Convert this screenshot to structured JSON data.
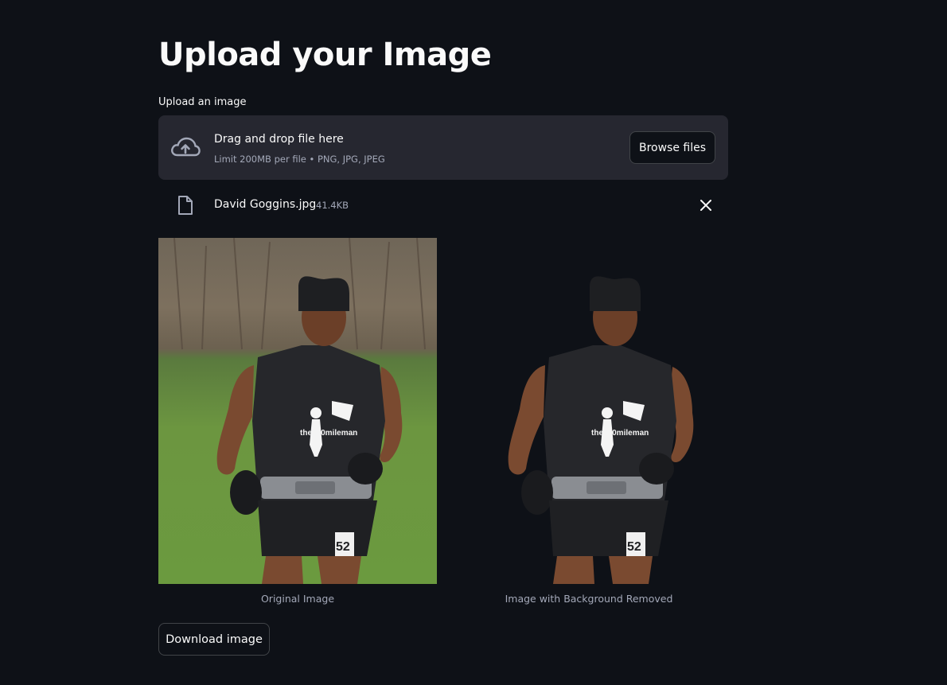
{
  "page": {
    "title": "Upload your Image",
    "upload_label": "Upload an image"
  },
  "uploader": {
    "drag_text": "Drag and drop file here",
    "limit_text": "Limit 200MB per file • PNG, JPG, JPEG",
    "browse_label": "Browse files",
    "icon": "cloud-upload-icon"
  },
  "uploaded_file": {
    "name": "David Goggins.jpg",
    "size": "41.4KB",
    "icon": "file-icon",
    "remove_icon": "close-icon"
  },
  "images": {
    "original_caption": "Original Image",
    "processed_caption": "Image with Background Removed",
    "shirt_text": "the100mileman",
    "bib_number": "52"
  },
  "actions": {
    "download_label": "Download image"
  },
  "colors": {
    "background": "#0e1117",
    "surface": "#262730",
    "text": "#fafafa",
    "muted": "#a3a8b8"
  }
}
